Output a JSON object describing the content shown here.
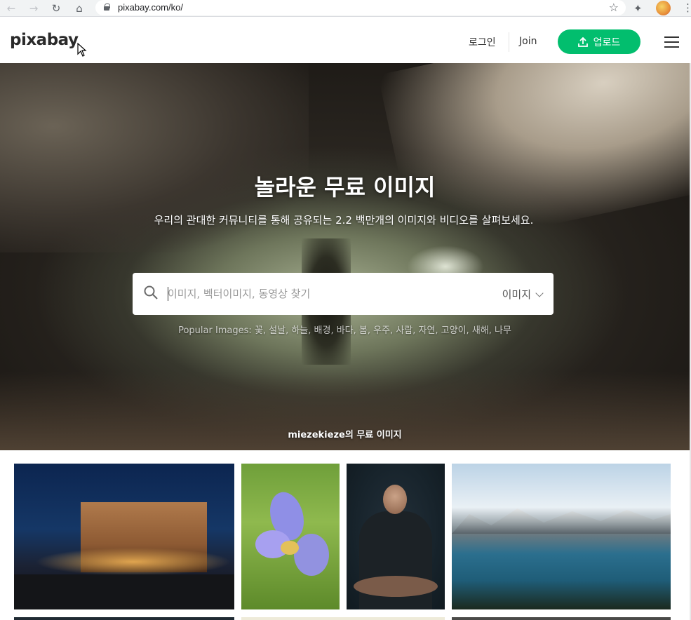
{
  "browser": {
    "url": "pixabay.com/ko/",
    "icons": [
      "back-icon",
      "forward-icon",
      "reload-icon",
      "home-icon",
      "lock-icon",
      "star-icon",
      "extensions-icon",
      "profile-avatar",
      "more-icon"
    ]
  },
  "header": {
    "logo": "pixabay",
    "login": "로그인",
    "join": "Join",
    "upload": "업로드"
  },
  "hero": {
    "title": "놀라운 무료 이미지",
    "subtitle": "우리의 관대한 커뮤니티를 통해 공유되는 2.2 백만개의 이미지와 비디오를 살펴보세요.",
    "search_placeholder": "이미지, 벡터이미지, 동영상 찾기",
    "search_type": "이미지",
    "popular": "Popular Images: 꽃, 설날, 하늘, 배경, 바다, 봄, 우주, 사람, 자연, 고양이, 새해, 나무",
    "credit": "miezekieze의 무료 이미지"
  },
  "colors": {
    "accent": "#02be6e",
    "text": "#333333"
  }
}
